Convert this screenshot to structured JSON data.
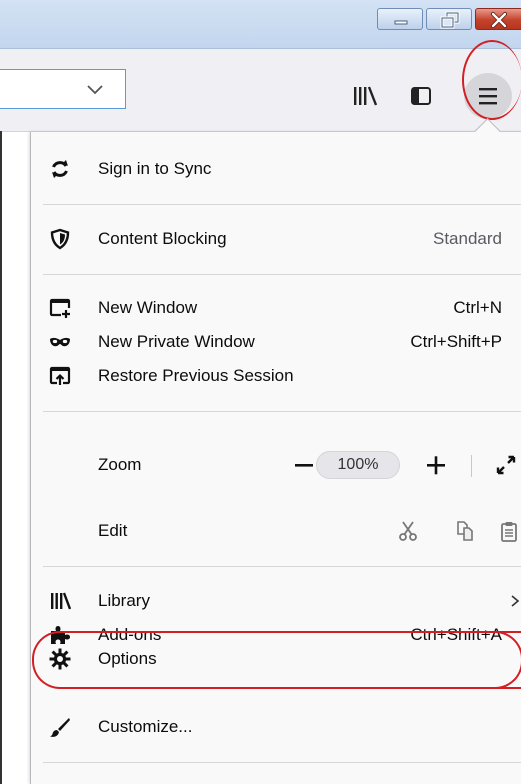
{
  "window": {
    "buttons": [
      "minimize",
      "maximize",
      "close"
    ]
  },
  "toolbar": {
    "icons": [
      "chevron-down-icon",
      "library-icon",
      "sidebar-icon",
      "hamburger-menu-icon"
    ]
  },
  "menu": {
    "sync_label": "Sign in to Sync",
    "content_blocking_label": "Content Blocking",
    "content_blocking_value": "Standard",
    "new_window_label": "New Window",
    "new_window_shortcut": "Ctrl+N",
    "new_private_window_label": "New Private Window",
    "new_private_window_shortcut": "Ctrl+Shift+P",
    "restore_session_label": "Restore Previous Session",
    "zoom_label": "Zoom",
    "zoom_minus": "−",
    "zoom_value": "100%",
    "zoom_plus": "+",
    "edit_label": "Edit",
    "library_label": "Library",
    "addons_label": "Add-ons",
    "addons_shortcut": "Ctrl+Shift+A",
    "options_label": "Options",
    "customize_label": "Customize..."
  },
  "highlight_color": "#d21f24"
}
